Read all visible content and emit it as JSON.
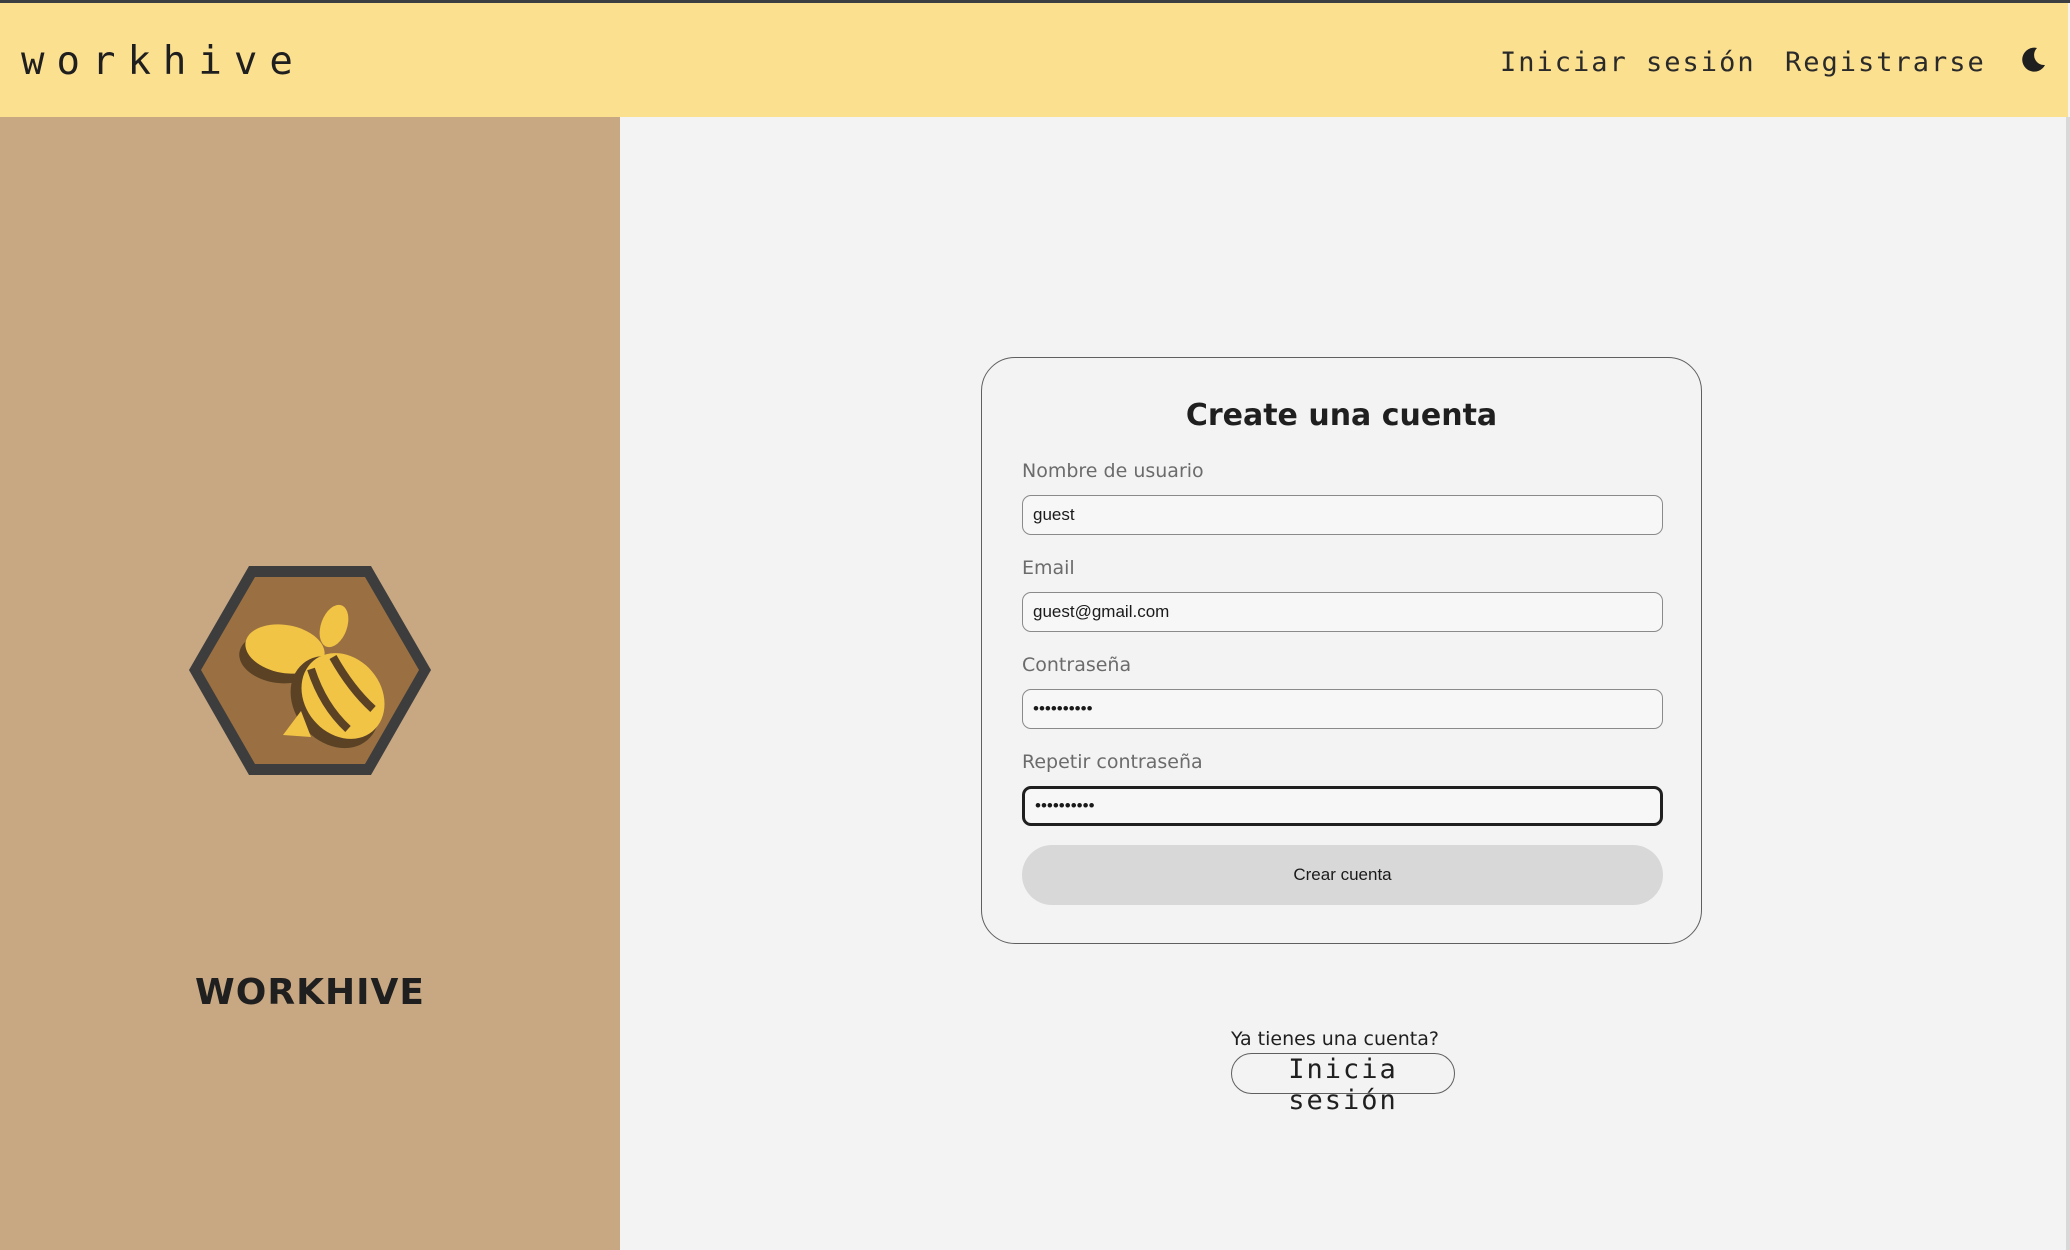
{
  "header": {
    "brand": "workhive",
    "nav": {
      "login_label": "Iniciar sesión",
      "register_label": "Registrarse"
    },
    "theme_toggle_icon": "moon-icon"
  },
  "sidebar": {
    "logo_icon": "bee-hexagon-logo",
    "title": "WORKHIVE"
  },
  "form": {
    "title": "Create una cuenta",
    "fields": {
      "username": {
        "label": "Nombre de usuario",
        "value": "guest"
      },
      "email": {
        "label": "Email",
        "value": "guest@gmail.com"
      },
      "password": {
        "label": "Contraseña",
        "value": "••••••••••"
      },
      "password_repeat": {
        "label": "Repetir contraseña",
        "value": "••••••••••"
      }
    },
    "submit_label": "Crear cuenta"
  },
  "footer_prompt": {
    "text": "Ya tienes una cuenta?",
    "link_label": "Inicia sesión"
  },
  "colors": {
    "header_bg": "#fbe08f",
    "sidebar_bg": "#c8a883",
    "page_bg": "#f3f3f3",
    "button_bg": "#d8d8d8",
    "logo_hex_dark": "#3d3d3d",
    "logo_hex_fill": "#9a7042",
    "logo_bee_yellow": "#f2c445"
  }
}
